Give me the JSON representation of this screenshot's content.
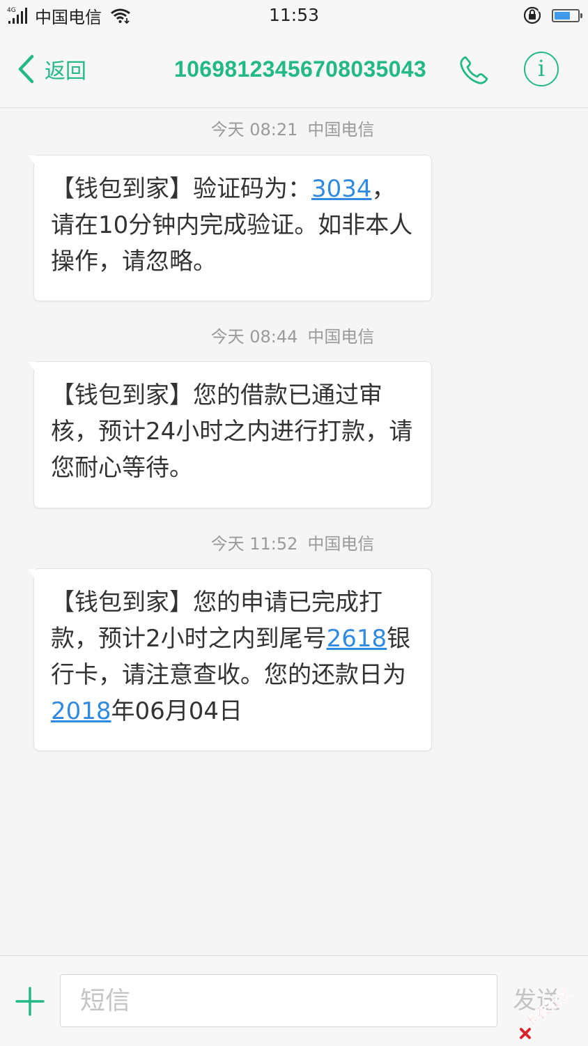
{
  "status_bar": {
    "network": "4G",
    "carrier": "中国电信",
    "time": "11:53"
  },
  "header": {
    "back_label": "返回",
    "contact": "106981234567080350​43",
    "contact_number": "10698123456708035043",
    "info_label": "i"
  },
  "messages": [
    {
      "date": "今天 08:21",
      "carrier": "中国电信",
      "parts": [
        {
          "text": "【钱包到家】验证码为：",
          "link": false
        },
        {
          "text": "3034",
          "link": true
        },
        {
          "text": "，请在10分钟内完成验证。如非本人操作，请忽略。",
          "link": false
        }
      ]
    },
    {
      "date": "今天 08:44",
      "carrier": "中国电信",
      "parts": [
        {
          "text": "【钱包到家】您的借款已通过审核，预计24小时之内进行打款，请您耐心等待。",
          "link": false
        }
      ]
    },
    {
      "date": "今天 11:52",
      "carrier": "中国电信",
      "parts": [
        {
          "text": "【钱包到家】您的申请已完成打款，预计2小时之内到尾号",
          "link": false
        },
        {
          "text": "2618",
          "link": true
        },
        {
          "text": "银行卡，请注意查收。您的还款日为",
          "link": false
        },
        {
          "text": "2018",
          "link": true
        },
        {
          "text": "年06月04日",
          "link": false
        }
      ]
    }
  ],
  "input_bar": {
    "placeholder": "短信",
    "send_label": "发送"
  },
  "watermark": {
    "text": "卡农社区"
  },
  "colors": {
    "accent": "#22b887",
    "link": "#2f8ae0",
    "battery": "#3d9be9"
  }
}
